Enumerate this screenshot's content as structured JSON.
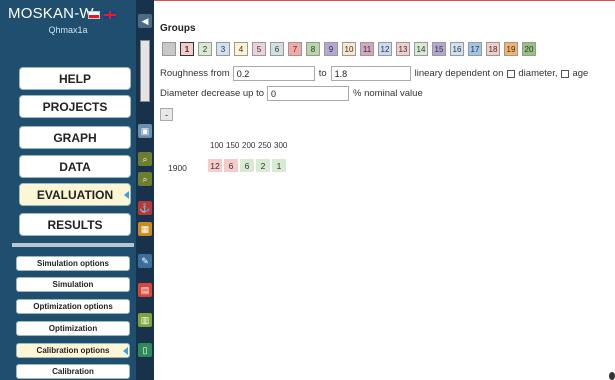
{
  "app": {
    "title": "MOSKAN-W",
    "user": "Qhmax1a"
  },
  "menu": [
    {
      "label": "HELP",
      "active": false
    },
    {
      "label": "PROJECTS",
      "active": false
    },
    {
      "label": "GRAPH",
      "active": false
    },
    {
      "label": "DATA",
      "active": false
    },
    {
      "label": "EVALUATION",
      "active": true
    },
    {
      "label": "RESULTS",
      "active": false
    }
  ],
  "submenu": [
    {
      "label": "Simulation options",
      "active": false
    },
    {
      "label": "Simulation",
      "active": false
    },
    {
      "label": "Optimization options",
      "active": false
    },
    {
      "label": "Optimization",
      "active": false
    },
    {
      "label": "Calibration options",
      "active": true
    },
    {
      "label": "Calibration",
      "active": false
    }
  ],
  "groups": {
    "title": "Groups",
    "buttons": [
      {
        "label": "",
        "color": "#c8c8c8"
      },
      {
        "label": "1",
        "color": "#f4cccc"
      },
      {
        "label": "2",
        "color": "#d9ead3"
      },
      {
        "label": "3",
        "color": "#cfe2f3"
      },
      {
        "label": "4",
        "color": "#fff2cc"
      },
      {
        "label": "5",
        "color": "#ead1dc"
      },
      {
        "label": "6",
        "color": "#d0e0e3"
      },
      {
        "label": "7",
        "color": "#f4a8a8"
      },
      {
        "label": "8",
        "color": "#b6d7a8"
      },
      {
        "label": "9",
        "color": "#b4a7d6"
      },
      {
        "label": "10",
        "color": "#fce5cd"
      },
      {
        "label": "11",
        "color": "#d5a6bd"
      },
      {
        "label": "12",
        "color": "#c9daf8"
      },
      {
        "label": "13",
        "color": "#f4cccc"
      },
      {
        "label": "14",
        "color": "#d9ead3"
      },
      {
        "label": "15",
        "color": "#b4a7d6"
      },
      {
        "label": "16",
        "color": "#cfe2f3"
      },
      {
        "label": "17",
        "color": "#9fc5e8"
      },
      {
        "label": "18",
        "color": "#f4cccc"
      },
      {
        "label": "19",
        "color": "#f6b26b"
      },
      {
        "label": "20",
        "color": "#93c47d"
      }
    ],
    "selected": "1"
  },
  "form": {
    "roughness_label": "Roughness from",
    "roughness_from": "0.2",
    "to_label": "to",
    "roughness_to": "1.8",
    "linear_label": "lineary dependent on",
    "diameter_label": "diameter,",
    "age_label": "age",
    "diameter_decrease_label": "Diameter decrease up to",
    "diameter_decrease_value": "0",
    "nominal_label": "% nominal value",
    "small_button": "-"
  },
  "table": {
    "headers": [
      "100",
      "150",
      "200",
      "250",
      "300"
    ],
    "row_label": "1900",
    "values": [
      {
        "v": "12",
        "color": "#f4cccc"
      },
      {
        "v": "6",
        "color": "#f4cccc"
      },
      {
        "v": "6",
        "color": "#d9ead3"
      },
      {
        "v": "2",
        "color": "#d9ead3"
      },
      {
        "v": "1",
        "color": "#d9ead3"
      }
    ]
  },
  "tools": [
    {
      "name": "back-icon",
      "glyph": "◀"
    },
    {
      "name": "save-icon",
      "glyph": "▣"
    },
    {
      "name": "zoom-in-icon",
      "glyph": "⌕"
    },
    {
      "name": "zoom-out-icon",
      "glyph": "⌕"
    },
    {
      "name": "network-icon",
      "glyph": "⚓"
    },
    {
      "name": "chart-icon",
      "glyph": "▦"
    },
    {
      "name": "edit-icon",
      "glyph": "✎"
    },
    {
      "name": "table-icon",
      "glyph": "▤"
    },
    {
      "name": "calc-icon",
      "glyph": "▥"
    },
    {
      "name": "graph-icon",
      "glyph": "▯"
    }
  ]
}
